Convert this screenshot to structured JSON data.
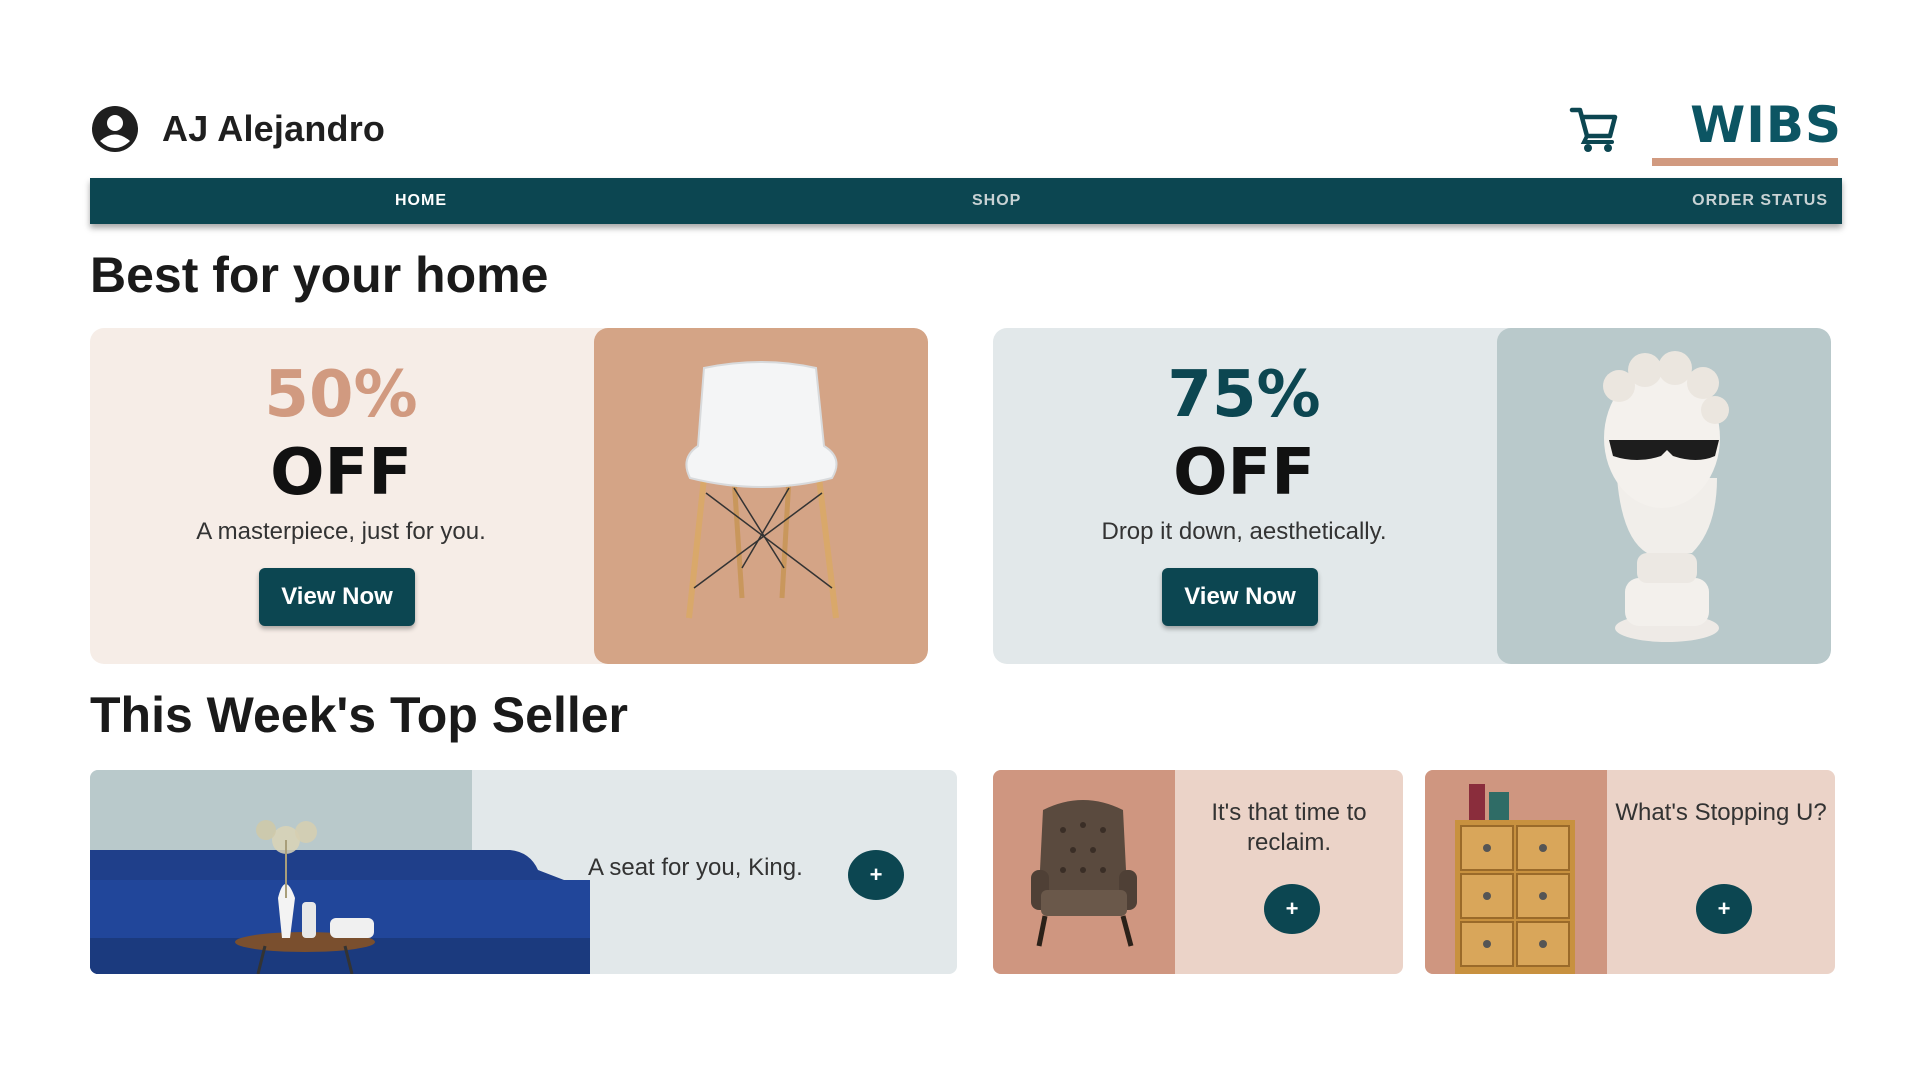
{
  "header": {
    "user_name": "AJ Alejandro",
    "user_icon": "user-circle-icon",
    "cart_icon": "cart-icon",
    "brand": "WIBS"
  },
  "nav": {
    "items": [
      {
        "label": "HOME",
        "active": true
      },
      {
        "label": "SHOP",
        "active": false
      },
      {
        "label": "ORDER STATUS",
        "active": false
      }
    ]
  },
  "sections": {
    "best_title": "Best for your home",
    "top_seller_title": "This Week's Top Seller"
  },
  "promos": [
    {
      "percent": "50%",
      "off": "OFF",
      "description": "A masterpiece, just for you.",
      "button": "View Now",
      "accent": "#d19a80",
      "image": "white-chair"
    },
    {
      "percent": "75%",
      "off": "OFF",
      "description": "Drop it down, aesthetically.",
      "button": "View Now",
      "accent": "#0c4651",
      "image": "bust-with-sunglasses"
    }
  ],
  "top_sellers": [
    {
      "caption": "A seat for you, King.",
      "button": "+",
      "image": "blue-sofa"
    },
    {
      "caption": "It's that time to reclaim.",
      "button": "+",
      "image": "leather-armchair"
    },
    {
      "caption": "What's Stopping U?",
      "button": "+",
      "image": "wooden-cabinet"
    }
  ],
  "colors": {
    "primary": "#0c4651",
    "brand": "#0c5563",
    "accent": "#d19a80"
  }
}
